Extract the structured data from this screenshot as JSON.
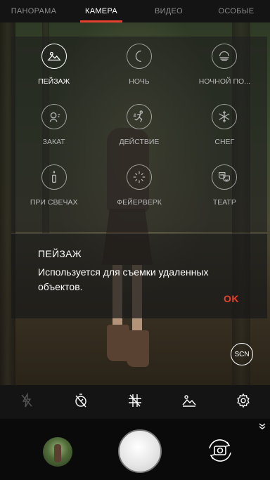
{
  "tabs": [
    "ПАНОРАМА",
    "КАМЕРА",
    "ВИДЕО",
    "ОСОБЫЕ"
  ],
  "active_tab": "КАМЕРА",
  "scenes": [
    {
      "label": "ПЕЙЗАЖ",
      "icon": "landscape-icon",
      "selected": true
    },
    {
      "label": "НОЧЬ",
      "icon": "moon-icon",
      "selected": false
    },
    {
      "label": "НОЧНОЙ ПО...",
      "icon": "night-portrait-icon",
      "selected": false
    },
    {
      "label": "ЗАКАТ",
      "icon": "sunset-icon",
      "selected": false
    },
    {
      "label": "ДЕЙСТВИЕ",
      "icon": "action-icon",
      "selected": false
    },
    {
      "label": "СНЕГ",
      "icon": "snowflake-icon",
      "selected": false
    },
    {
      "label": "ПРИ СВЕЧАХ",
      "icon": "candle-icon",
      "selected": false
    },
    {
      "label": "ФЕЙЕРВЕРК",
      "icon": "fireworks-icon",
      "selected": false
    },
    {
      "label": "ТЕАТР",
      "icon": "theater-icon",
      "selected": false
    }
  ],
  "description": {
    "title": "ПЕЙЗАЖ",
    "text": "Используется для съемки удаленных объектов.",
    "ok_label": "OK"
  },
  "scn_label": "SCN",
  "colors": {
    "accent": "#e8412c"
  }
}
